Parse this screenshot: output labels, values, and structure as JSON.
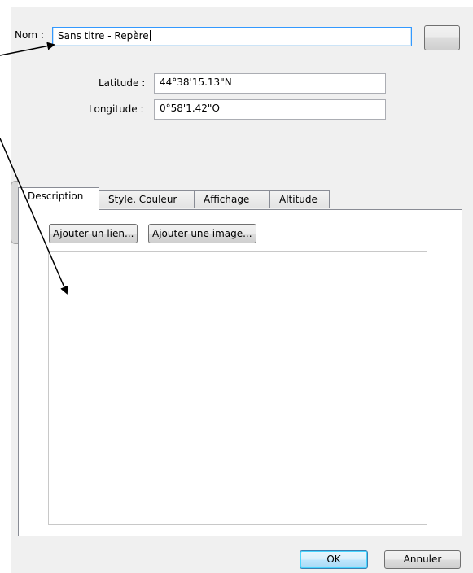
{
  "form": {
    "name_label": "Nom :",
    "name_value": "Sans titre - Repère",
    "latitude_label": "Latitude :",
    "latitude_value": "44°38'15.13\"N",
    "longitude_label": "Longitude :",
    "longitude_value": "0°58'1.42\"O"
  },
  "tabs": [
    {
      "label": "Description",
      "active": true
    },
    {
      "label": "Style, Couleur",
      "active": false
    },
    {
      "label": "Affichage",
      "active": false
    },
    {
      "label": "Altitude",
      "active": false
    }
  ],
  "description": {
    "add_link_label": "Ajouter un lien...",
    "add_image_label": "Ajouter une image..."
  },
  "footer": {
    "ok_label": "OK",
    "cancel_label": "Annuler"
  },
  "annotations": {
    "arrow_color": "#000000"
  }
}
